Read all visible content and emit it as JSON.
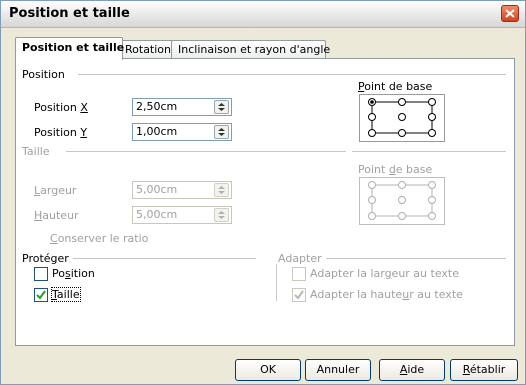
{
  "window": {
    "title": "Position et taille"
  },
  "tabs": [
    {
      "label": "Position et taille",
      "active": true
    },
    {
      "label": "Rotation"
    },
    {
      "label": "Inclinaison et rayon d'angle"
    }
  ],
  "position_group": {
    "label": "Position",
    "x": {
      "pre": "Position ",
      "mn": "X",
      "value": "2,50cm"
    },
    "y": {
      "pre": "Position ",
      "mn": "Y",
      "value": "1,00cm"
    },
    "base_point": {
      "pre": "",
      "mn": "P",
      "post": "oint de base"
    }
  },
  "size_group": {
    "label": "Taille",
    "width": {
      "pre": "",
      "mn": "L",
      "post": "argeur",
      "value": "5,00cm"
    },
    "height": {
      "pre": "",
      "mn": "H",
      "post": "auteur",
      "value": "5,00cm"
    },
    "keep_ratio": {
      "pre": "",
      "mn": "C",
      "post": "onserver le ratio",
      "checked": false
    },
    "base_point": {
      "pre": "Point ",
      "mn": "d",
      "post": "e base"
    }
  },
  "protect_group": {
    "label": "Protéger",
    "position": {
      "pre": "Po",
      "mn": "s",
      "post": "ition",
      "checked": false
    },
    "size": {
      "pre": "",
      "mn": "T",
      "post": "aille",
      "checked": true
    }
  },
  "adapt_group": {
    "label": "Adapter",
    "fit_width": {
      "pre": "Adapter la lar",
      "mn": "g",
      "post": "eur au texte",
      "checked": false
    },
    "fit_height": {
      "pre": "Adapter la haute",
      "mn": "u",
      "post": "r au texte",
      "checked": true
    }
  },
  "buttons": {
    "ok": "OK",
    "cancel": "Annuler",
    "help": {
      "pre": "",
      "mn": "A",
      "post": "ide"
    },
    "reset": {
      "pre": "",
      "mn": "R",
      "post": "établir"
    }
  }
}
